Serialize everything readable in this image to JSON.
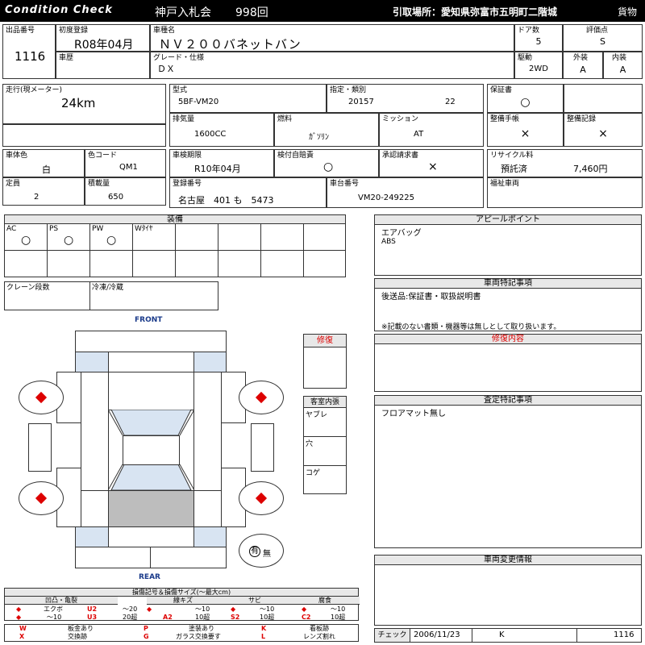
{
  "header": {
    "logo": "Condition Check",
    "auction": "神戸入札会",
    "lot_session": "998回",
    "location": "引取場所：愛知県弥富市五明町二階城",
    "type": "貨物"
  },
  "row1": {
    "lot_no_label": "出品番号",
    "lot_no": "1116",
    "first_reg_label": "初度登録",
    "first_reg": "R08年04月",
    "name_label": "車種名",
    "name": "ＮＶ２００バネットバン",
    "door_label": "ドア数",
    "door": "5",
    "rating_label": "評価点",
    "rating": "S",
    "history_label": "車歴",
    "grade_label": "グレード・仕様",
    "grade": "ＤＸ",
    "drive_label": "駆動",
    "drive": "2WD",
    "ext_label": "外装",
    "ext": "A",
    "int_label": "内装",
    "int": "A"
  },
  "row2": {
    "mileage_label": "走行(現メーター)",
    "mileage": "24km",
    "model_label": "型式",
    "model": "5BF-VM20",
    "spec_label": "指定・類別",
    "spec1": "20157",
    "spec2": "22",
    "warranty_label": "保証書",
    "warranty": "○",
    "disp_label": "排気量",
    "disp": "1600CC",
    "fuel_label": "燃料",
    "fuel": "ｶﾞｿﾘﾝ",
    "mission_label": "ミッション",
    "mission": "AT",
    "maint_label": "整備手帳",
    "maint": "×",
    "record_label": "整備記録",
    "record": "×"
  },
  "row3": {
    "body_color_label": "車体色",
    "body_color": "白",
    "color_code_label": "色コード",
    "color_code": "QM1",
    "inspection_label": "車検期限",
    "inspection": "R10年04月",
    "insurance_label": "検付自賠責",
    "insurance": "○",
    "approval_label": "承認請求書",
    "approval": "×",
    "recycle_label": "リサイクル料",
    "recycle_status": "預託済",
    "recycle_amount": "7,460円",
    "capacity_label": "定員",
    "capacity": "2",
    "load_label": "積載量",
    "load": "650",
    "reg_label": "登録番号",
    "reg": "名古屋　401 も　5473",
    "chassis_label": "車台番号",
    "chassis": "VM20-249225",
    "welfare_label": "福祉車両"
  },
  "equipment": {
    "title": "装備",
    "items": [
      {
        "label": "AC",
        "mark": "○"
      },
      {
        "label": "PS",
        "mark": "○"
      },
      {
        "label": "PW",
        "mark": "○"
      },
      {
        "label": "Wﾀｲﾔ",
        "mark": ""
      }
    ],
    "crane_label": "クレーン段数",
    "cold_label": "冷凍/冷蔵"
  },
  "diagram": {
    "front": "FRONT",
    "rear": "REAR",
    "repair_label": "修復",
    "cabin_label": "客室内張",
    "cabin_items": [
      "ヤブレ",
      "穴",
      "コゲ"
    ],
    "tire_label": "有",
    "tire_label2": "無"
  },
  "right": {
    "appeal_title": "アピールポイント",
    "appeal_lines": [
      "エアバッグ",
      "ABS"
    ],
    "special_title": "車両特記事項",
    "special_line1": "後送品:保証書・取扱説明書",
    "special_line2": "※記載のない書類・機器等は無しとして取り扱います。",
    "repair_title": "修復内容",
    "assess_title": "査定特記事項",
    "assess_line": "フロアマット無し",
    "change_title": "車両変更情報"
  },
  "legend": {
    "title": "損傷記号＆損傷サイズ(〜最大cm)",
    "groups": [
      {
        "name": "凹凸・亀裂",
        "a_label": "エクボ",
        "b_code": "U2",
        "b_text": "〜20",
        "c_text": "〜10",
        "d_code": "U3",
        "d_text": "20超"
      },
      {
        "name": "線キズ",
        "a_code": "A1",
        "a_text": "〜10",
        "b_code": "A2",
        "b_text": "10超"
      },
      {
        "name": "サビ",
        "a_code": "S1",
        "a_text": "〜10",
        "b_code": "S2",
        "b_text": "10超"
      },
      {
        "name": "腐食",
        "a_code": "C1",
        "a_text": "〜10",
        "b_code": "C2",
        "b_text": "10超"
      }
    ],
    "marks": [
      {
        "k": "W",
        "t": "板金あり"
      },
      {
        "k": "X",
        "t": "交換跡"
      },
      {
        "k": "P",
        "t": "塗装あり"
      },
      {
        "k": "G",
        "t": "ガラス交換要す"
      },
      {
        "k": "K",
        "t": "看板跡"
      },
      {
        "k": "L",
        "t": "レンズ割れ"
      }
    ]
  },
  "check": {
    "label": "チェック",
    "date": "2006/11/23",
    "code": "K",
    "number": "1116"
  }
}
